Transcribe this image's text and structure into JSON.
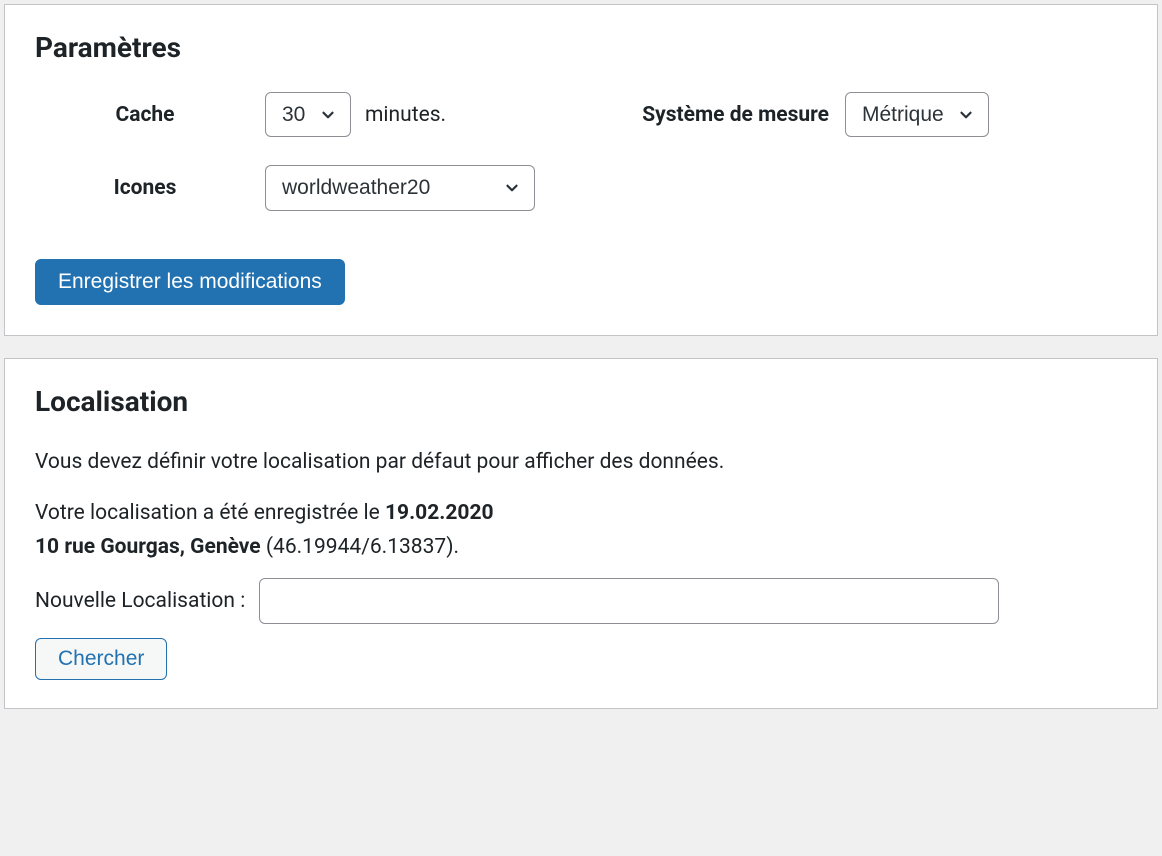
{
  "settings": {
    "heading": "Paramètres",
    "cache_label": "Cache",
    "cache_value": "30",
    "cache_unit": "minutes.",
    "measure_label": "Système de mesure",
    "measure_value": "Métrique",
    "icons_label": "Icones",
    "icons_value": "worldweather20",
    "save_button": "Enregistrer les modifications"
  },
  "localisation": {
    "heading": "Localisation",
    "intro": "Vous devez définir votre localisation par défaut pour afficher des données.",
    "saved_prefix": "Votre localisation a été enregistrée le ",
    "saved_date": "19.02.2020",
    "saved_address": "10 rue Gourgas, Genève",
    "saved_coords": " (46.19944/6.13837).",
    "new_label": "Nouvelle Localisation :",
    "new_value": "",
    "search_button": "Chercher"
  }
}
